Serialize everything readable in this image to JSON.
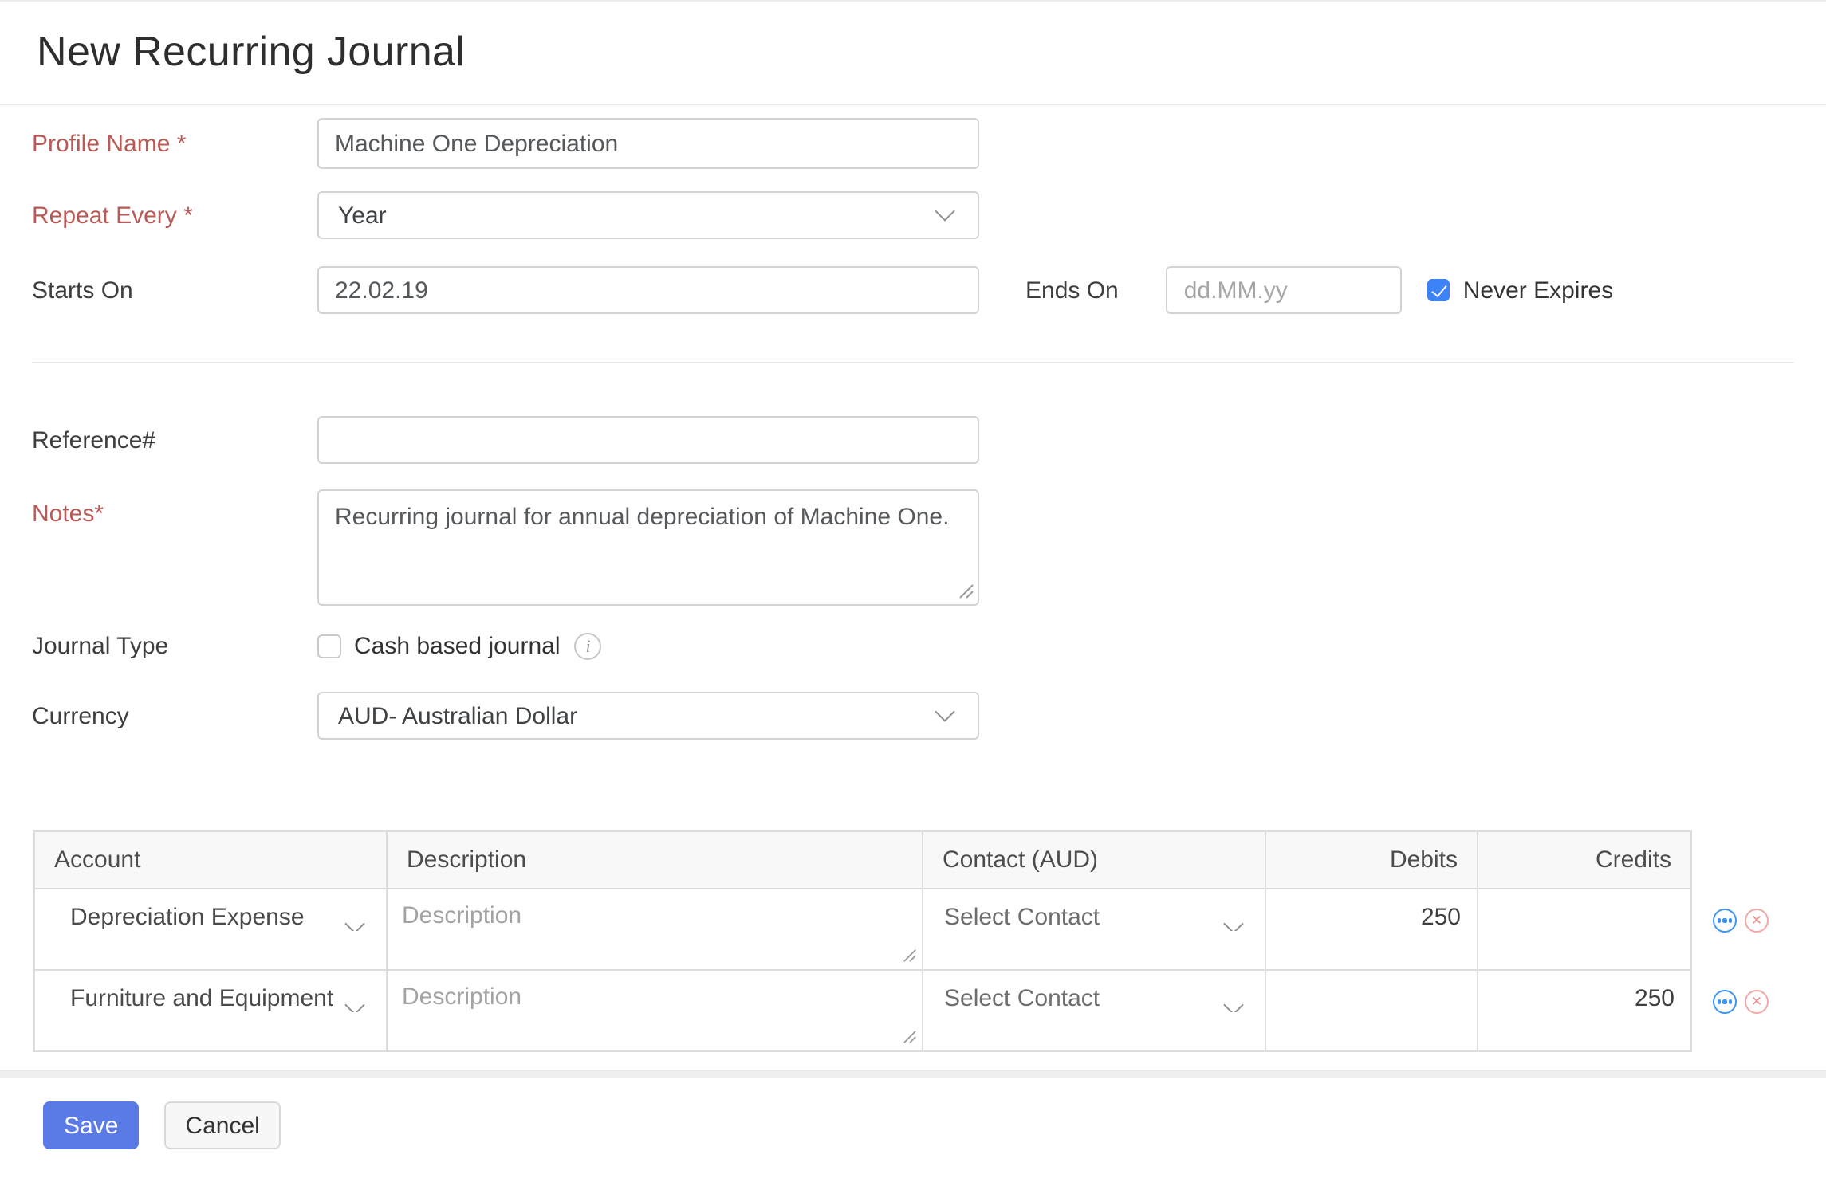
{
  "title": "New Recurring Journal",
  "form": {
    "profile_name": {
      "label": "Profile Name *",
      "value": "Machine One Depreciation"
    },
    "repeat_every": {
      "label": "Repeat Every *",
      "value": "Year"
    },
    "starts_on": {
      "label": "Starts On",
      "value": "22.02.19"
    },
    "ends_on": {
      "label": "Ends On",
      "placeholder": "dd.MM.yy"
    },
    "never_expires": {
      "label": "Never Expires",
      "checked": true
    },
    "reference": {
      "label": "Reference#",
      "value": ""
    },
    "notes": {
      "label": "Notes*",
      "value": "Recurring journal for annual depreciation of Machine One."
    },
    "journal_type": {
      "label": "Journal Type",
      "checkbox_label": "Cash based journal",
      "checked": false
    },
    "currency": {
      "label": "Currency",
      "value": "AUD- Australian Dollar"
    }
  },
  "table": {
    "headers": {
      "account": "Account",
      "description": "Description",
      "contact": "Contact (AUD)",
      "debits": "Debits",
      "credits": "Credits"
    },
    "rows": [
      {
        "account": "Depreciation Expense",
        "description_placeholder": "Description",
        "contact": "Select Contact",
        "debits": "250",
        "credits": ""
      },
      {
        "account": "Furniture and Equipment",
        "description_placeholder": "Description",
        "contact": "Select Contact",
        "debits": "",
        "credits": "250"
      }
    ]
  },
  "buttons": {
    "save": "Save",
    "cancel": "Cancel"
  },
  "icons": {
    "dropdown": "chevron-down-icon",
    "info": "info-circle-icon",
    "row_more": "ellipsis-circle-icon",
    "row_remove": "remove-circle-icon",
    "resize": "textarea-resize-handle-icon"
  },
  "colors": {
    "save_button": "#5a7be6",
    "checkbox_checked": "#3c83f7",
    "required_label": "#b85a56",
    "row_more_icon": "#3d96f2",
    "row_remove_icon": "#ea8f8c",
    "table_header_bg": "#f8f8f8"
  }
}
